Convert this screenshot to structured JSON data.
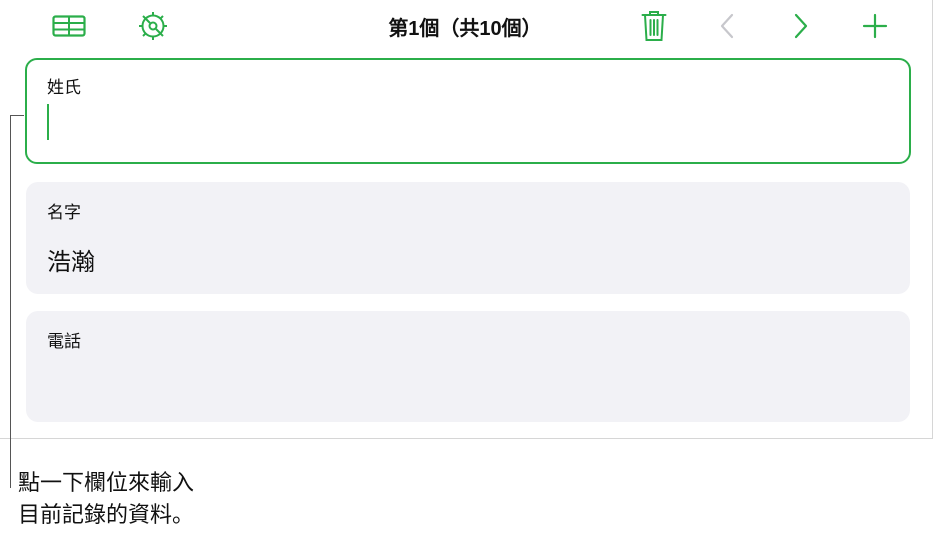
{
  "toolbar": {
    "title": "第1個（共10個）",
    "icons": [
      "table-icon",
      "settings-gear-icon",
      "trash-icon",
      "chevron-left-icon",
      "chevron-right-icon",
      "plus-icon"
    ],
    "accent_color": "#2bae4a",
    "disabled_color": "#c7c7cc"
  },
  "fields": [
    {
      "label": "姓氏",
      "value": "",
      "active": true
    },
    {
      "label": "名字",
      "value": "浩瀚",
      "active": false
    },
    {
      "label": "電話",
      "value": "",
      "active": false
    }
  ],
  "callout": {
    "line1": "點一下欄位來輸入",
    "line2": "目前記錄的資料。"
  }
}
